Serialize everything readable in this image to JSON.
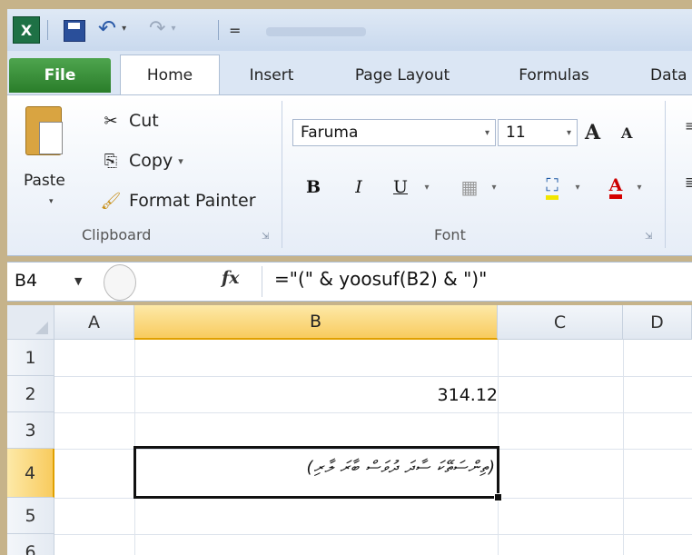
{
  "quick_access": {
    "app_icon_glyph": "X",
    "undo_glyph": "↶",
    "redo_glyph": "↷",
    "customize_glyph": "="
  },
  "tabs": [
    "File",
    "Home",
    "Insert",
    "Page Layout",
    "Formulas",
    "Data"
  ],
  "clipboard": {
    "paste": "Paste",
    "cut": "Cut",
    "copy": "Copy",
    "copy_arrow": "▾",
    "format_painter": "Format Painter",
    "group_label": "Clipboard"
  },
  "font": {
    "name": "Faruma",
    "size": "11",
    "grow": "A",
    "shrink": "A",
    "bold": "B",
    "italic": "I",
    "underline": "U",
    "group_label": "Font"
  },
  "formula_bar": {
    "name_box": "B4",
    "fx": "fx",
    "formula": "=\"(\" & yoosuf(B2) & \")\""
  },
  "grid": {
    "columns": [
      "A",
      "B",
      "C",
      "D"
    ],
    "rows": [
      "1",
      "2",
      "3",
      "4",
      "5",
      "6"
    ],
    "B2": "314.12",
    "B4": "(ތިންސަތޭކަ ސާދަ ދުވަސް ބާރަ ލާރި)"
  },
  "colors": {
    "file_tab": "#2a7d2a",
    "selected_header": "#f8cb5e",
    "active_border": "#111111"
  }
}
